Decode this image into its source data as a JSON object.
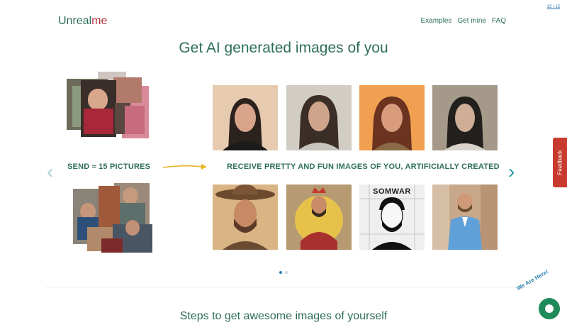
{
  "lang_switch": "13 / 15",
  "logo": {
    "part1": "Unreal",
    "part2": "me"
  },
  "nav": [
    "Examples",
    "Get mine",
    "FAQ"
  ],
  "hero_title": "Get AI generated images of you",
  "send_label": "SEND ≈ 15 PICTURES",
  "receive_label": "RECEIVE PRETTY AND FUN IMAGES OF YOU, ARTIFICIALLY CREATED",
  "tile_badge": "SOMWAR",
  "carousel": {
    "slides": 2,
    "active": 0
  },
  "steps_title": "Steps to get awesome images of yourself",
  "feedback_label": "Feedback",
  "chat_label": "We Are Here!",
  "colors": {
    "brand_green": "#2e6e5c",
    "brand_red": "#b8323f",
    "feedback": "#c8392e",
    "chat": "#1f8a5a",
    "arrow_yellow": "#e8b522"
  }
}
